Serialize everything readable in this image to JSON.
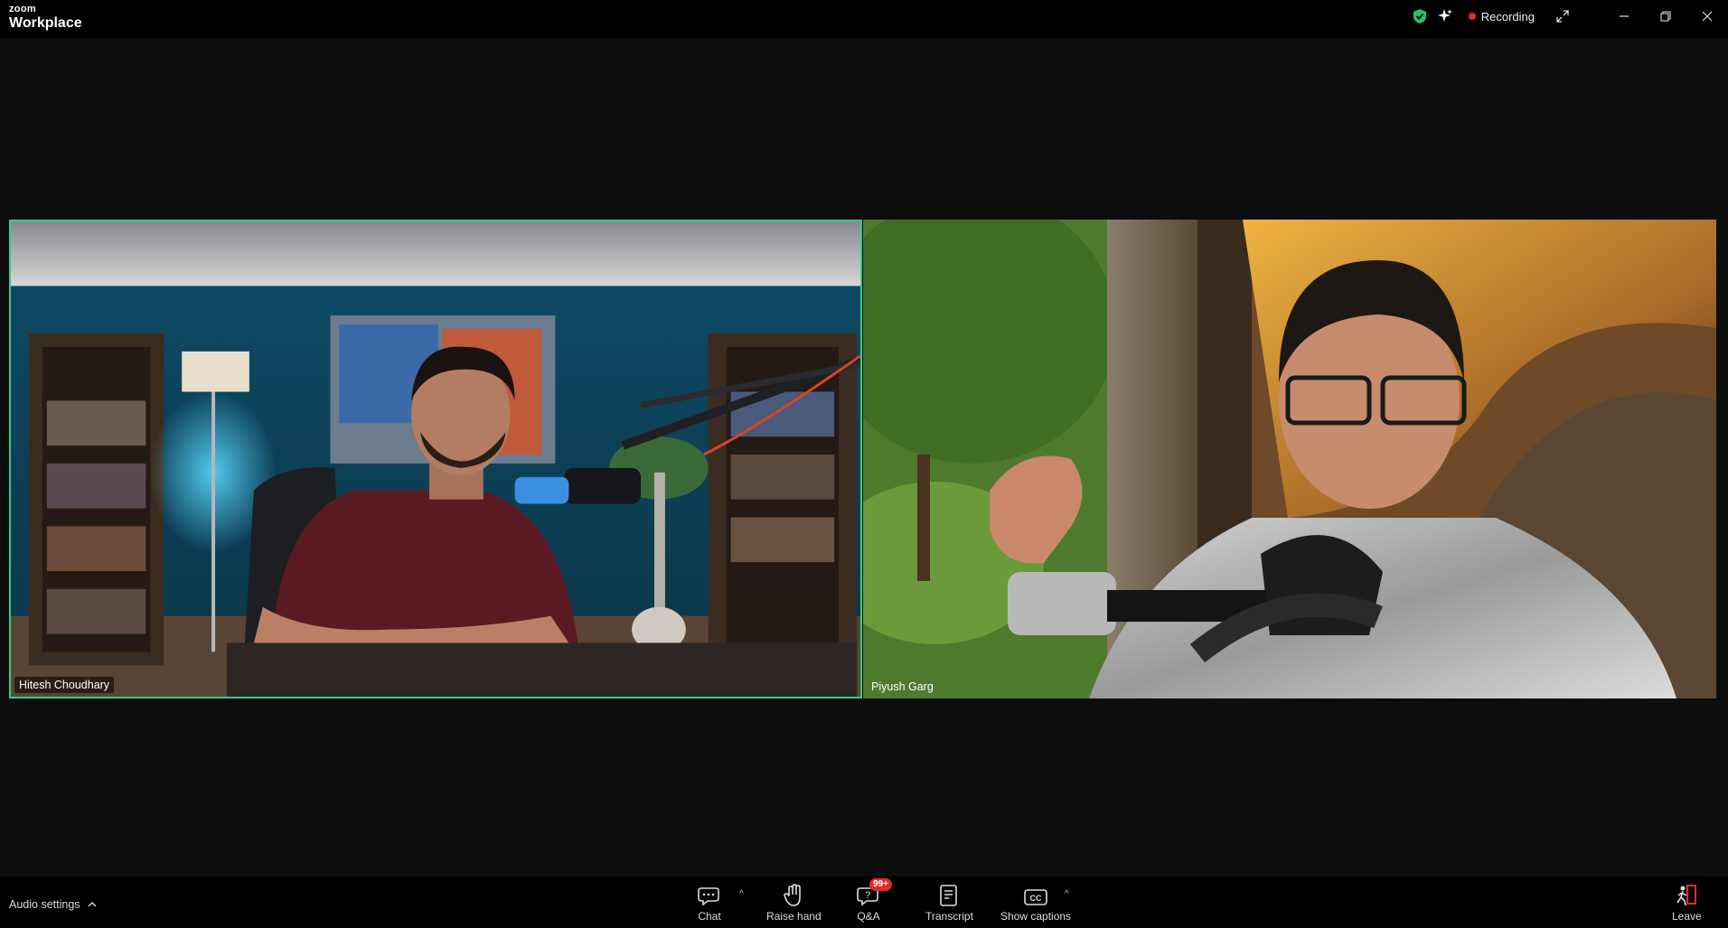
{
  "app": {
    "brand_small": "zoom",
    "brand_large": "Workplace"
  },
  "titlebar": {
    "recording_label": "Recording",
    "colors": {
      "shield": "#22c55e",
      "recording_dot": "#e02b2b"
    }
  },
  "participants": [
    {
      "name": "Hitesh Choudhary",
      "active_speaker": true,
      "highlight_color": "#2fd08a"
    },
    {
      "name": "Piyush Garg",
      "active_speaker": false
    }
  ],
  "toolbar": {
    "audio_settings": "Audio settings",
    "chat": "Chat",
    "raise_hand": "Raise hand",
    "qa": "Q&A",
    "qa_badge": "99+",
    "transcript": "Transcript",
    "show_captions": "Show captions",
    "leave": "Leave",
    "leave_color": "#e02b2b"
  }
}
